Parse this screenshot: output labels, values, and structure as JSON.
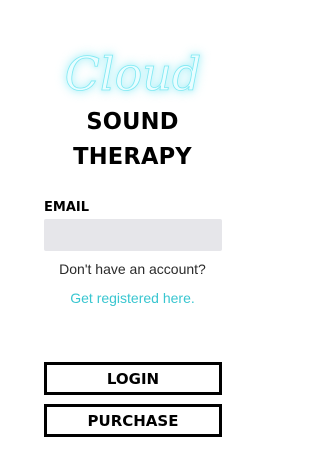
{
  "logo": {
    "script_text": "Cloud",
    "glow_color": "#5fe3f0"
  },
  "title": {
    "line1": "SOUND",
    "line2": "THERAPY"
  },
  "email": {
    "label": "EMAIL",
    "value": "",
    "placeholder": ""
  },
  "signup": {
    "prompt": "Don't have an account?",
    "link_text": "Get registered here."
  },
  "buttons": {
    "login_label": "LOGIN",
    "purchase_label": "PURCHASE"
  },
  "colors": {
    "accent": "#39c6d0",
    "input_bg": "#e6e6ea",
    "text": "#000000"
  }
}
